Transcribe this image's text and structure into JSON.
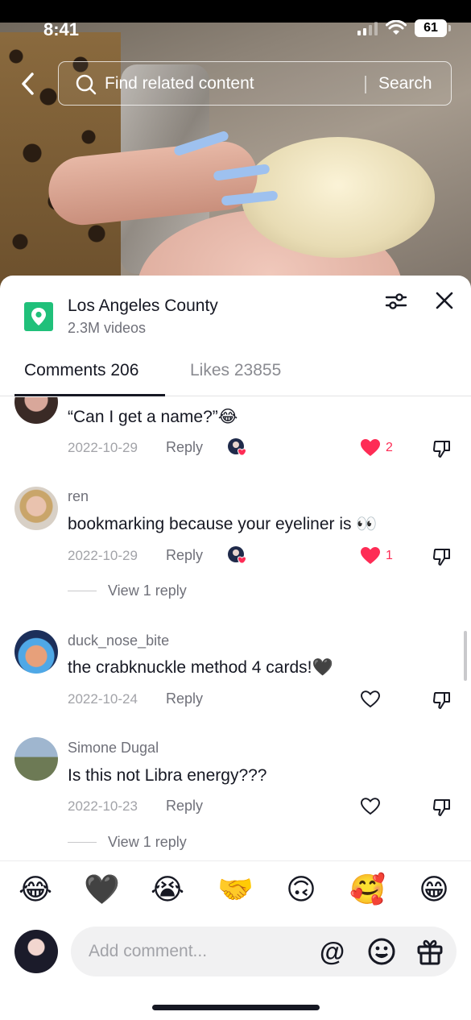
{
  "status_bar": {
    "time": "8:41",
    "battery": "61"
  },
  "search": {
    "placeholder": "Find related content",
    "button": "Search"
  },
  "location": {
    "title": "Los Angeles County",
    "subtitle": "2.3M videos"
  },
  "tabs": [
    {
      "label": "Comments 206",
      "active": true
    },
    {
      "label": "Likes 23855",
      "active": false
    }
  ],
  "comments": [
    {
      "username": "",
      "text": "“Can I get a name?”😂",
      "date": "2022-10-29",
      "reply_label": "Reply",
      "liked_by_creator": true,
      "liked": true,
      "like_count": "2"
    },
    {
      "username": "ren",
      "text": "bookmarking because your eyeliner is 👀",
      "date": "2022-10-29",
      "reply_label": "Reply",
      "liked_by_creator": true,
      "liked": true,
      "like_count": "1",
      "view_replies": "View 1 reply"
    },
    {
      "username": "duck_nose_bite",
      "text": "the crabknuckle method 4 cards!🖤",
      "date": "2022-10-24",
      "reply_label": "Reply",
      "liked_by_creator": false,
      "liked": false,
      "like_count": ""
    },
    {
      "username": "Simone Dugal",
      "text": "Is this not Libra energy???",
      "date": "2022-10-23",
      "reply_label": "Reply",
      "liked_by_creator": false,
      "liked": false,
      "like_count": "",
      "view_replies": "View 1 reply"
    }
  ],
  "emoji_bar": [
    "😂",
    "🖤",
    "😭",
    "🤝",
    "🙃",
    "🥰",
    "😁"
  ],
  "input": {
    "placeholder": "Add comment..."
  },
  "icons": {
    "back": "chevron-left-icon",
    "search": "search-icon",
    "filter": "sliders-icon",
    "close": "close-icon",
    "location": "map-pin-icon",
    "like": "heart-icon",
    "dislike": "thumbs-down-icon",
    "mention": "at-icon",
    "emoji": "smile-icon",
    "gift": "gift-icon"
  },
  "colors": {
    "accent_like": "#fe2c55",
    "location_green": "#20c07a",
    "text_primary": "#161823",
    "text_secondary": "#6f7079"
  }
}
